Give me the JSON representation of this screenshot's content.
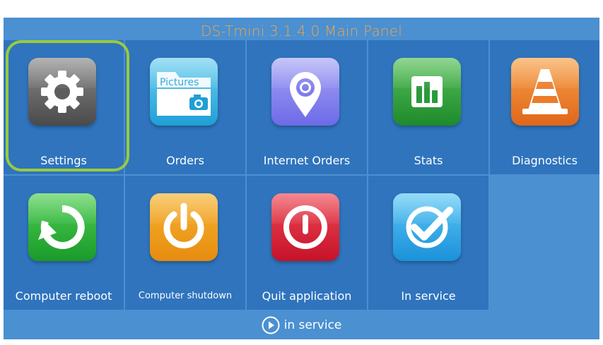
{
  "window": {
    "title": "DS-Tmini 3.1.4.0 Main Panel"
  },
  "tiles": [
    {
      "label": "Settings",
      "icon": "gear-icon"
    },
    {
      "label": "Orders",
      "icon": "pictures-folder-icon",
      "icon_text": "Pictures"
    },
    {
      "label": "Internet Orders",
      "icon": "location-pin-icon"
    },
    {
      "label": "Stats",
      "icon": "bar-chart-icon"
    },
    {
      "label": "Diagnostics",
      "icon": "traffic-cone-icon"
    },
    {
      "label": "Computer reboot",
      "icon": "reboot-icon"
    },
    {
      "label": "Computer shutdown",
      "icon": "power-icon"
    },
    {
      "label": "Quit application",
      "icon": "quit-icon"
    },
    {
      "label": "In service",
      "icon": "checkmark-icon"
    }
  ],
  "selected_tile": "Settings",
  "status": {
    "text": "in service",
    "icon": "play-circle-icon"
  },
  "colors": {
    "background": "#4b90d1",
    "tile": "#2f74bd",
    "title": "#f0a44a",
    "selection": "#9acb3c"
  }
}
